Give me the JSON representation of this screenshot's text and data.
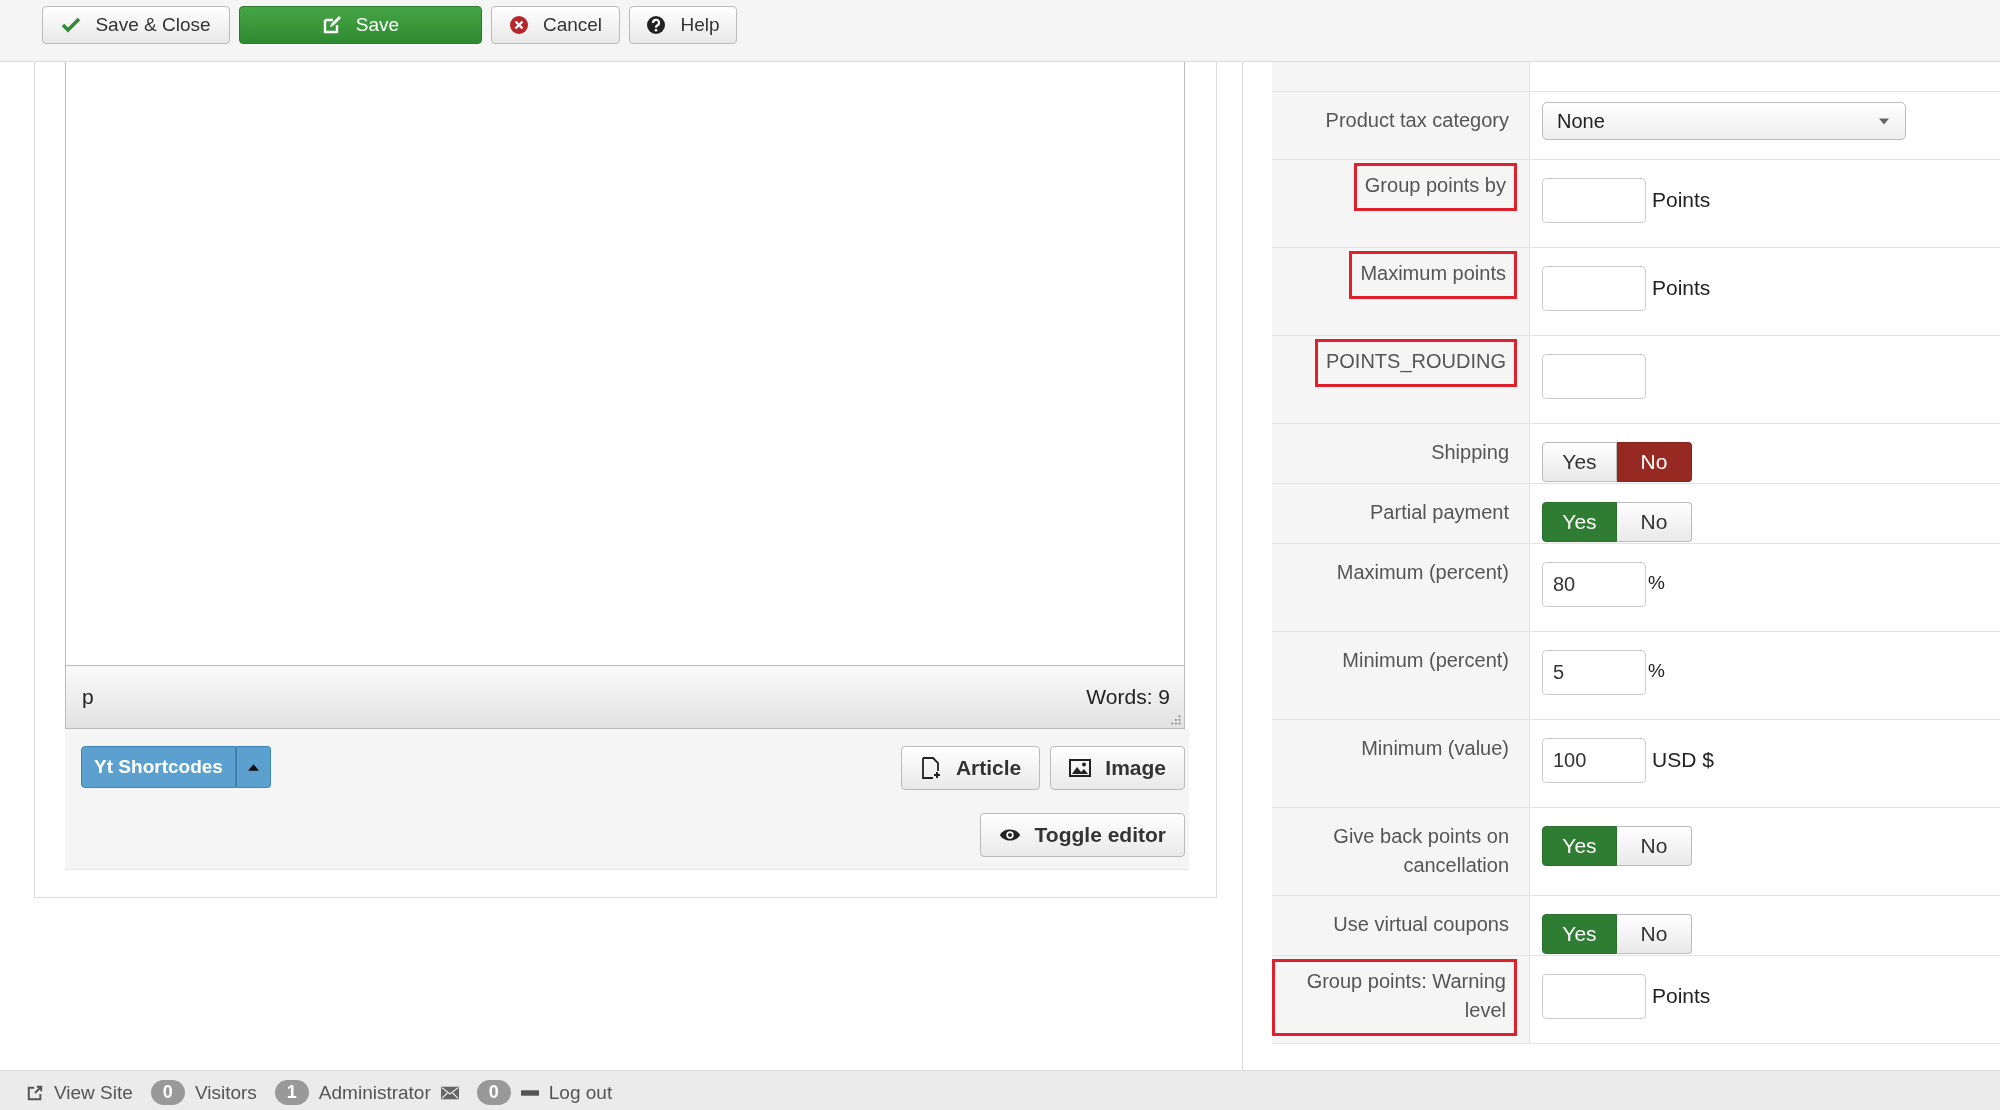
{
  "toolbar": [
    {
      "label": "Save & Close",
      "kind": "check"
    },
    {
      "label": "Save",
      "kind": "primary"
    },
    {
      "label": "Cancel",
      "kind": "cancel"
    },
    {
      "label": "Help",
      "kind": "help"
    }
  ],
  "editor": {
    "path": "p",
    "word_count": "Words: 9",
    "shortcodes_button": "Yt Shortcodes",
    "buttons": [
      {
        "label": "Article",
        "kind": "article"
      },
      {
        "label": "Image",
        "kind": "image"
      }
    ],
    "toggle_button": "Toggle editor"
  },
  "form": {
    "rows": [
      {
        "label": "Product tax category",
        "kind": "select",
        "value": "None",
        "highlighted": false
      },
      {
        "label": "Group points by",
        "kind": "text",
        "unit": "Points",
        "highlighted": true
      },
      {
        "label": "Maximum points",
        "kind": "text",
        "unit": "Points",
        "highlighted": true
      },
      {
        "label": "POINTS_ROUDING",
        "kind": "text",
        "highlighted": true
      },
      {
        "label": "Shipping",
        "kind": "toggle",
        "options": [
          {
            "label": "Yes",
            "selected": false
          },
          {
            "label": "No",
            "selected": true
          }
        ],
        "highlighted": false
      },
      {
        "label": "Partial payment",
        "kind": "toggle",
        "options": [
          {
            "label": "Yes",
            "selected": true
          },
          {
            "label": "No",
            "selected": false
          }
        ],
        "highlighted": false
      },
      {
        "label": "Maximum (percent)",
        "kind": "text",
        "value": "80",
        "unit": "%",
        "highlighted": false
      },
      {
        "label": "Minimum (percent)",
        "kind": "text",
        "value": "5",
        "unit": "%",
        "highlighted": false
      },
      {
        "label": "Minimum (value)",
        "kind": "text",
        "value": "100",
        "unit": "USD $",
        "highlighted": false
      },
      {
        "label": "Give back points on cancellation",
        "kind": "toggle",
        "options": [
          {
            "label": "Yes",
            "selected": true
          },
          {
            "label": "No",
            "selected": false
          }
        ],
        "highlighted": false
      },
      {
        "label": "Use virtual coupons",
        "kind": "toggle",
        "options": [
          {
            "label": "Yes",
            "selected": true
          },
          {
            "label": "No",
            "selected": false
          }
        ],
        "highlighted": false
      },
      {
        "label": "Group points: Warning level",
        "kind": "text",
        "unit": "Points",
        "highlighted": true
      }
    ]
  },
  "status_bar": {
    "view_site": "View Site",
    "visitors_count": "0",
    "visitors": "Visitors",
    "admins_count": "1",
    "administrator": "Administrator",
    "messages_count": "0",
    "logout": "Log out"
  }
}
